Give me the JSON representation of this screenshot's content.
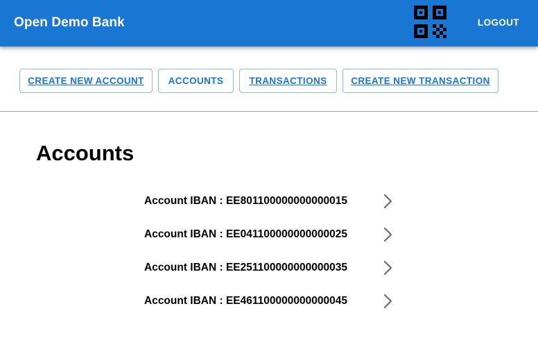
{
  "header": {
    "title": "Open Demo Bank",
    "qr_icon": "qr-code-icon",
    "logout_label": "LOGOUT",
    "background_color": "#1976d2",
    "text_color": "#ffffff"
  },
  "nav": {
    "buttons": [
      {
        "label": "CREATE NEW ACCOUNT",
        "underlined": true
      },
      {
        "label": "ACCOUNTS",
        "underlined": false
      },
      {
        "label": "TRANSACTIONS",
        "underlined": true
      },
      {
        "label": "CREATE NEW TRANSACTION",
        "underlined": true
      }
    ],
    "accent_color": "#1976d2"
  },
  "main": {
    "title": "Accounts",
    "accounts": [
      {
        "label": "Account IBAN : EE801100000000000015",
        "icon": "chevron-right-icon"
      },
      {
        "label": "Account IBAN : EE041100000000000025",
        "icon": "chevron-right-icon"
      },
      {
        "label": "Account IBAN : EE251100000000000035",
        "icon": "chevron-right-icon"
      },
      {
        "label": "Account IBAN : EE461100000000000045",
        "icon": "chevron-right-icon"
      }
    ]
  }
}
